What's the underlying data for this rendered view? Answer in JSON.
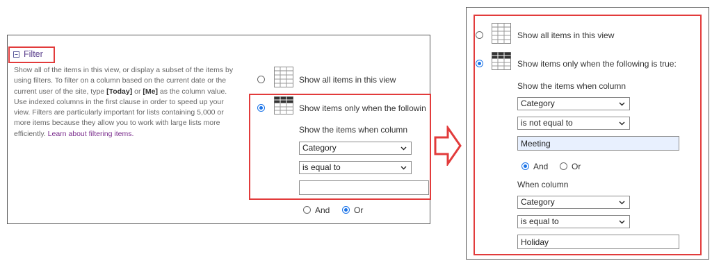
{
  "left_panel": {
    "filter_label": "Filter",
    "description": {
      "part1": "Show all of the items in this view, or display a subset of the items by using filters. To filter on a column based on the current date or the current user of the site, type ",
      "today": "[Today]",
      "or_word": " or ",
      "me": "[Me]",
      "part2": " as the column value. Use indexed columns in the first clause in order to speed up your view. Filters are particularly important for lists containing 5,000 or more items because they allow you to work with large lists more efficiently. ",
      "link": "Learn about filtering items."
    },
    "show_all_label": "Show all items in this view",
    "show_when_label": "Show items only when the followin",
    "show_column_label": "Show the items when column",
    "column_select": "Category",
    "operator_select": "is equal to",
    "value_input": "",
    "and_label": "And",
    "or_label": "Or"
  },
  "right_panel": {
    "show_all_label": "Show all items in this view",
    "show_when_label": "Show items only when the following is true:",
    "show_column_label": "Show the items when column",
    "column1_select": "Category",
    "operator1_select": "is not equal to",
    "value1_input": "Meeting",
    "and_label": "And",
    "or_label": "Or",
    "when_column_label": "When column",
    "column2_select": "Category",
    "operator2_select": "is equal to",
    "value2_input": "Holiday"
  },
  "colors": {
    "highlight": "#e23b3b",
    "radio_selected": "#1a73e8",
    "link": "#7b2d8e",
    "filled_input_bg": "#e8f0fe"
  }
}
